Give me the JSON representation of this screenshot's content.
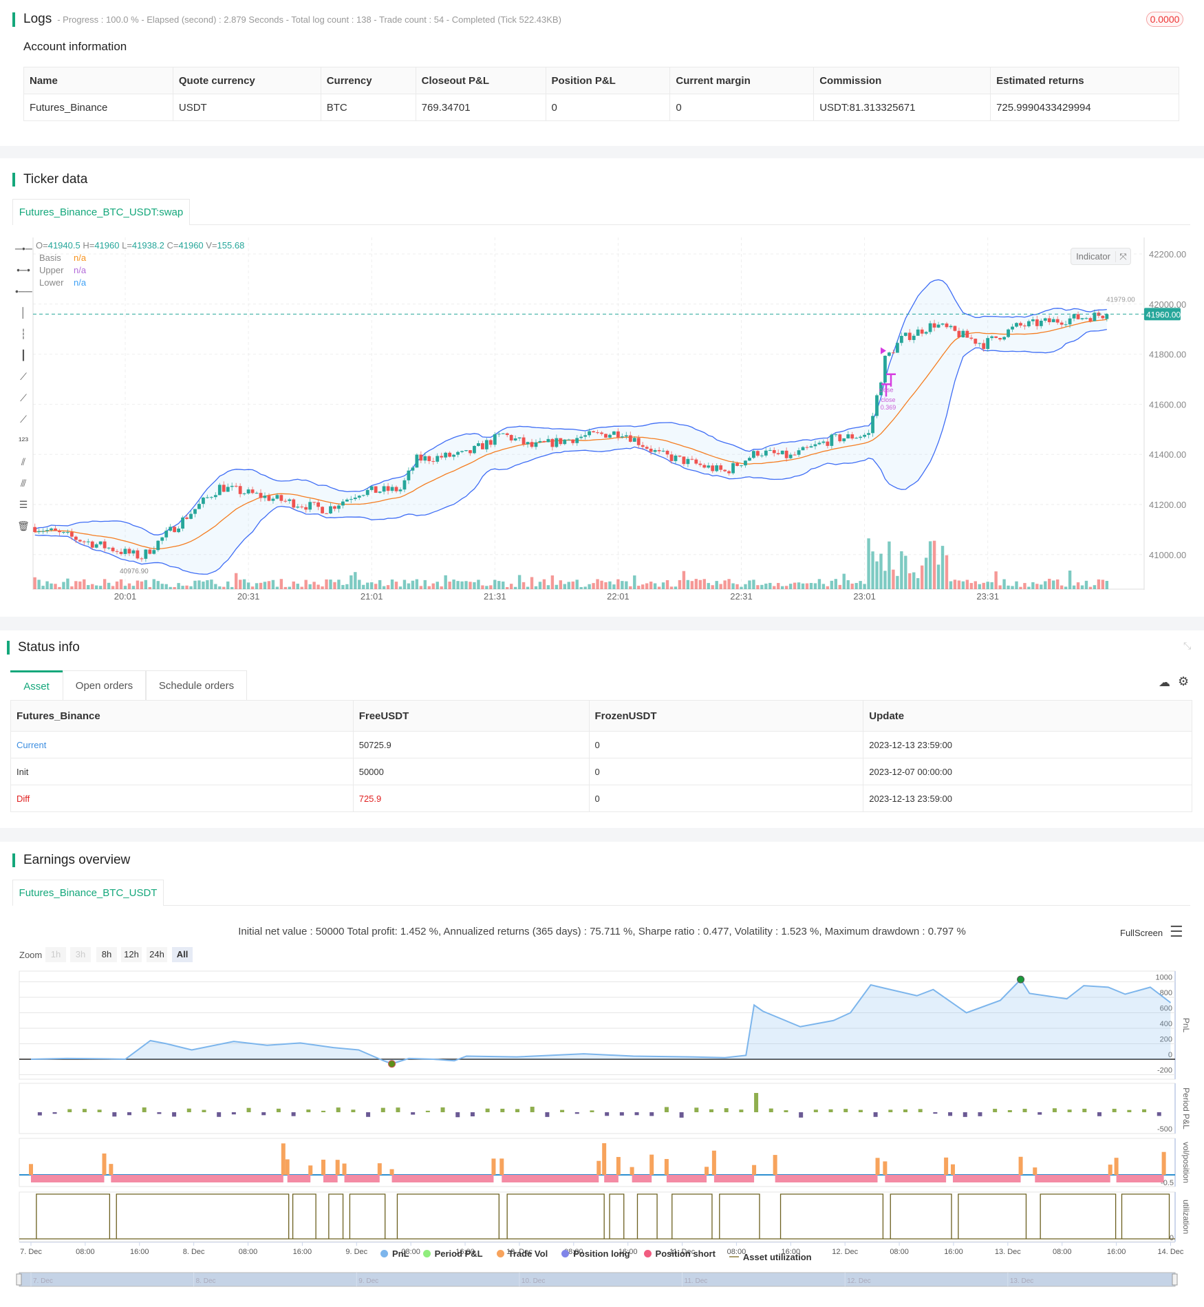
{
  "logs": {
    "title": "Logs",
    "summary": "- Progress : 100.0 % - Elapsed (second) : 2.879  Seconds - Total log count : 138 - Trade count : 54 - Completed (Tick 522.43KB)",
    "badge": "0.0000"
  },
  "account": {
    "title": "Account information",
    "headers": [
      "Name",
      "Quote currency",
      "Currency",
      "Closeout P&L",
      "Position P&L",
      "Current margin",
      "Commission",
      "Estimated returns"
    ],
    "row": [
      "Futures_Binance",
      "USDT",
      "BTC",
      "769.34701",
      "0",
      "0",
      "USDT:81.313325671",
      "725.9990433429994"
    ]
  },
  "ticker": {
    "title": "Ticker data",
    "tab": "Futures_Binance_BTC_USDT:swap",
    "ohlc": {
      "o_label": "O=",
      "o": "41940.5",
      "h_label": " H=",
      "h": "41960",
      "l_label": " L=",
      "l": "41938.2",
      "c_label": " C=",
      "c": "41960",
      "v_label": " V=",
      "v": "155.68"
    },
    "legend": [
      {
        "name": "Basis",
        "value": "n/a",
        "color": "#f7931e"
      },
      {
        "name": "Upper",
        "value": "n/a",
        "color": "#b36bd9"
      },
      {
        "name": "Lower",
        "value": "n/a",
        "color": "#3da0f5"
      }
    ],
    "indicator_button": "Indicator",
    "last_price": "41960.00",
    "high_mark": "41979.00",
    "low_mark": "40976.90",
    "marker_close": "close",
    "marker_close2": "close",
    "marker_qty": "0.369",
    "y_ticks": [
      "42200.00",
      "42000.00",
      "41800.00",
      "41600.00",
      "41400.00",
      "41200.00",
      "41000.00"
    ],
    "x_ticks": [
      "20:01",
      "20:31",
      "21:01",
      "21:31",
      "22:01",
      "22:31",
      "23:01",
      "23:31"
    ]
  },
  "chart_data": {
    "type": "candlestick",
    "interval_minutes": 1,
    "start_offset_min": -22,
    "end_offset_min": 239,
    "price_keypoints": [
      [
        -22,
        41110
      ],
      [
        4,
        40990
      ],
      [
        10,
        41080
      ],
      [
        23,
        41270
      ],
      [
        34,
        41230
      ],
      [
        49,
        41180
      ],
      [
        57,
        41250
      ],
      [
        67,
        41260
      ],
      [
        71,
        41380
      ],
      [
        83,
        41400
      ],
      [
        92,
        41480
      ],
      [
        99,
        41430
      ],
      [
        111,
        41470
      ],
      [
        121,
        41490
      ],
      [
        130,
        41400
      ],
      [
        146,
        41330
      ],
      [
        154,
        41410
      ],
      [
        162,
        41390
      ],
      [
        172,
        41460
      ],
      [
        181,
        41480
      ],
      [
        185,
        41780
      ],
      [
        189,
        41860
      ],
      [
        197,
        41920
      ],
      [
        209,
        41840
      ],
      [
        217,
        41910
      ],
      [
        225,
        41930
      ],
      [
        239,
        41960
      ]
    ],
    "ylim": [
      40900,
      42250
    ],
    "bollinger": {
      "period": 20,
      "mult": 2
    },
    "colors": {
      "up": "#26a69a",
      "down": "#ef5350",
      "basis": "#f57c1f",
      "band": "#3d6cf5"
    }
  },
  "status": {
    "title": "Status info",
    "tabs": [
      "Asset",
      "Open orders",
      "Schedule orders"
    ],
    "headers": [
      "Futures_Binance",
      "FreeUSDT",
      "FrozenUSDT",
      "Update"
    ],
    "rows": [
      [
        "Current",
        "50725.9",
        "0",
        "2023-12-13 23:59:00"
      ],
      [
        "Init",
        "50000",
        "0",
        "2023-12-07 00:00:00"
      ],
      [
        "Diff",
        "725.9",
        "0",
        "2023-12-13 23:59:00"
      ]
    ]
  },
  "earnings": {
    "title": "Earnings overview",
    "tab": "Futures_Binance_BTC_USDT",
    "summary": "Initial net value : 50000 Total profit: 1.452 %, Annualized returns (365 days) : 75.711 %, Sharpe ratio : 0.477, Volatility : 1.523 %, Maximum drawdown : 0.797 %",
    "fullscreen": "FullScreen",
    "zoom_label": "Zoom",
    "zoom_buttons": [
      "1h",
      "3h",
      "8h",
      "12h",
      "24h",
      "All"
    ],
    "pnl_ticks": [
      "1000",
      "800",
      "600",
      "400",
      "200",
      "0",
      "-200"
    ],
    "axis_titles": [
      "PnL",
      "Period P&L",
      "vol/position",
      "utilization"
    ],
    "period_tick": "-500",
    "vol_tick": "-0.5",
    "util_tick": "0",
    "x_ticks": [
      "7. Dec",
      "08:00",
      "16:00",
      "8. Dec",
      "08:00",
      "16:00",
      "9. Dec",
      "08:00",
      "16:00",
      "10. Dec",
      "08:00",
      "16:00",
      "11. Dec",
      "08:00",
      "16:00",
      "12. Dec",
      "08:00",
      "16:00",
      "13. Dec",
      "08:00",
      "16:00",
      "14. Dec"
    ],
    "nav_ticks": [
      "7. Dec",
      "8. Dec",
      "9. Dec",
      "10. Dec",
      "11. Dec",
      "12. Dec",
      "13. Dec"
    ],
    "legend": [
      {
        "name": "PnL",
        "color": "#7cb5ec"
      },
      {
        "name": "Period P&L",
        "color": "#90ed7d"
      },
      {
        "name": "Trade Vol",
        "color": "#f7a35c"
      },
      {
        "name": "Position long",
        "color": "#8085e9"
      },
      {
        "name": "Position short",
        "color": "#f15c80"
      },
      {
        "name": "Asset utilization",
        "color": "#a89b6a"
      }
    ],
    "pnl_series": [
      [
        0,
        0
      ],
      [
        5.3,
        10
      ],
      [
        11.4,
        5
      ],
      [
        13.9,
        0
      ],
      [
        17.6,
        240
      ],
      [
        20,
        200
      ],
      [
        23.7,
        120
      ],
      [
        29.9,
        230
      ],
      [
        34.8,
        180
      ],
      [
        39.7,
        210
      ],
      [
        44.6,
        150
      ],
      [
        48.3,
        120
      ],
      [
        52,
        -20
      ],
      [
        53.2,
        -60
      ],
      [
        55.7,
        10
      ],
      [
        59.3,
        0
      ],
      [
        62.4,
        -20
      ],
      [
        64.2,
        40
      ],
      [
        71.6,
        30
      ],
      [
        81.5,
        70
      ],
      [
        88.8,
        40
      ],
      [
        97.4,
        30
      ],
      [
        102.3,
        20
      ],
      [
        105.4,
        50
      ],
      [
        106.6,
        700
      ],
      [
        107.9,
        620
      ],
      [
        113.4,
        420
      ],
      [
        118.3,
        500
      ],
      [
        120.8,
        600
      ],
      [
        123.8,
        960
      ],
      [
        125.7,
        920
      ],
      [
        130.6,
        820
      ],
      [
        133,
        900
      ],
      [
        137.9,
        600
      ],
      [
        142.9,
        760
      ],
      [
        145.9,
        1030
      ],
      [
        147.2,
        850
      ],
      [
        152.7,
        780
      ],
      [
        155.2,
        950
      ],
      [
        158.8,
        930
      ],
      [
        161.3,
        840
      ],
      [
        165,
        930
      ],
      [
        168,
        730
      ]
    ],
    "short_periods": [
      [
        0,
        10.8
      ],
      [
        11.8,
        37.2
      ],
      [
        37.8,
        41.2
      ],
      [
        43.1,
        45.2
      ],
      [
        46.2,
        51.4
      ],
      [
        53.2,
        68.2
      ],
      [
        69.4,
        83.7
      ],
      [
        84.5,
        86.6
      ],
      [
        88.6,
        91.5
      ],
      [
        93.7,
        99.6
      ],
      [
        100.7,
        106.6
      ],
      [
        109.7,
        124.8
      ],
      [
        125.9,
        134.9
      ],
      [
        135.9,
        145.9
      ],
      [
        148,
        159.1
      ],
      [
        160,
        167
      ]
    ]
  }
}
